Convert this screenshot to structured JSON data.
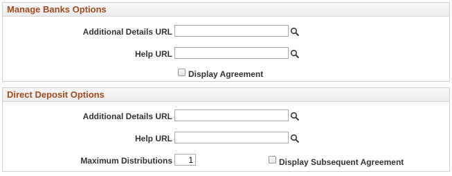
{
  "manage_banks": {
    "title": "Manage Banks Options",
    "additional_details_label": "Additional Details URL",
    "additional_details_value": "",
    "help_label": "Help URL",
    "help_value": "",
    "display_agreement_label": "Display Agreement",
    "display_agreement_checked": false
  },
  "direct_deposit": {
    "title": "Direct Deposit Options",
    "additional_details_label": "Additional Details URL",
    "additional_details_value": "",
    "help_label": "Help URL",
    "help_value": "",
    "max_distributions_label": "Maximum Distributions",
    "max_distributions_value": "1",
    "display_subsequent_label": "Display Subsequent Agreement",
    "display_subsequent_checked": false
  },
  "icons": {
    "lookup": "search-icon"
  },
  "colors": {
    "group_title": "#a04a1e",
    "border": "#cfcfcf"
  }
}
